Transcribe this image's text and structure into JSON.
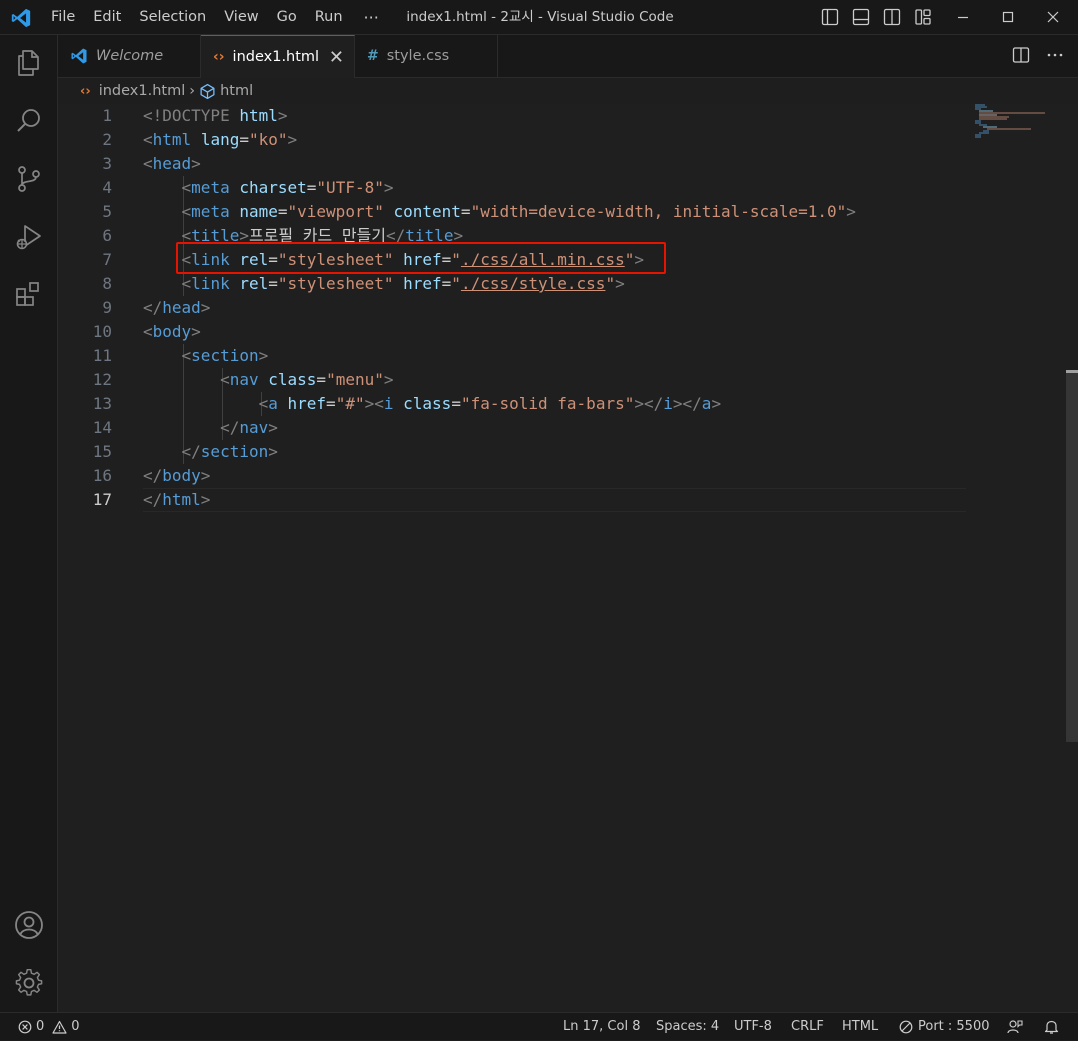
{
  "titlebar": {
    "menu": [
      "File",
      "Edit",
      "Selection",
      "View",
      "Go",
      "Run"
    ],
    "more": "···",
    "window_title": "index1.html - 2교시 - Visual Studio Code"
  },
  "tabs": [
    {
      "label": "Welcome",
      "icon": "vscode-icon",
      "italic": true
    },
    {
      "label": "index1.html",
      "icon": "html-file-icon",
      "active": true
    },
    {
      "label": "style.css",
      "icon": "css-file-icon"
    }
  ],
  "breadcrumb": {
    "file": "index1.html",
    "symbol": "html"
  },
  "editor": {
    "current_line": 17,
    "lines": [
      {
        "n": "1"
      },
      {
        "n": "2"
      },
      {
        "n": "3"
      },
      {
        "n": "4"
      },
      {
        "n": "5"
      },
      {
        "n": "6"
      },
      {
        "n": "7"
      },
      {
        "n": "8"
      },
      {
        "n": "9"
      },
      {
        "n": "10"
      },
      {
        "n": "11"
      },
      {
        "n": "12"
      },
      {
        "n": "13"
      },
      {
        "n": "14"
      },
      {
        "n": "15"
      },
      {
        "n": "16"
      },
      {
        "n": "17"
      }
    ],
    "tokens": {
      "l1": [
        "<!DOCTYPE",
        " ",
        "html",
        ">"
      ],
      "l2": [
        "<",
        "html",
        " ",
        "lang",
        "=",
        "\"ko\"",
        ">"
      ],
      "l3": [
        "<",
        "head",
        ">"
      ],
      "l4": [
        "    ",
        "<",
        "meta",
        " ",
        "charset",
        "=",
        "\"UTF-8\"",
        ">"
      ],
      "l5": [
        "    ",
        "<",
        "meta",
        " ",
        "name",
        "=",
        "\"viewport\"",
        " ",
        "content",
        "=",
        "\"width=device-width, initial-scale=1.0\"",
        ">"
      ],
      "l6": [
        "    ",
        "<",
        "title",
        ">",
        "프로필 카드 만들기",
        "</",
        "title",
        ">"
      ],
      "l7": [
        "    ",
        "<",
        "link",
        " ",
        "rel",
        "=",
        "\"stylesheet\"",
        " ",
        "href",
        "=",
        "\"",
        "./css/all.min.css",
        "\"",
        ">"
      ],
      "l8": [
        "    ",
        "<",
        "link",
        " ",
        "rel",
        "=",
        "\"stylesheet\"",
        " ",
        "href",
        "=",
        "\"",
        "./css/style.css",
        "\"",
        ">"
      ],
      "l9": [
        "</",
        "head",
        ">"
      ],
      "l10": [
        "<",
        "body",
        ">"
      ],
      "l11": [
        "    ",
        "<",
        "section",
        ">"
      ],
      "l12": [
        "        ",
        "<",
        "nav",
        " ",
        "class",
        "=",
        "\"menu\"",
        ">"
      ],
      "l13": [
        "            ",
        "<",
        "a",
        " ",
        "href",
        "=",
        "\"#\"",
        "><",
        "i",
        " ",
        "class",
        "=",
        "\"fa-solid fa-bars\"",
        "></",
        "i",
        "></",
        "a",
        ">"
      ],
      "l14": [
        "        ",
        "</",
        "nav",
        ">"
      ],
      "l15": [
        "    ",
        "</",
        "section",
        ">"
      ],
      "l16": [
        "</",
        "body",
        ">"
      ],
      "l17": [
        "</",
        "html",
        ">"
      ]
    }
  },
  "statusbar": {
    "errors": "0",
    "warnings": "0",
    "position": "Ln 17, Col 8",
    "spaces": "Spaces: 4",
    "encoding": "UTF-8",
    "eol": "CRLF",
    "language": "HTML",
    "port": "Port : 5500"
  },
  "colors": {
    "tag": "#569cd6",
    "attribute": "#9cdcfe",
    "string": "#ce9178",
    "bracket": "#808080",
    "highlight_box": "#e51400",
    "accent": "#0078d4"
  }
}
